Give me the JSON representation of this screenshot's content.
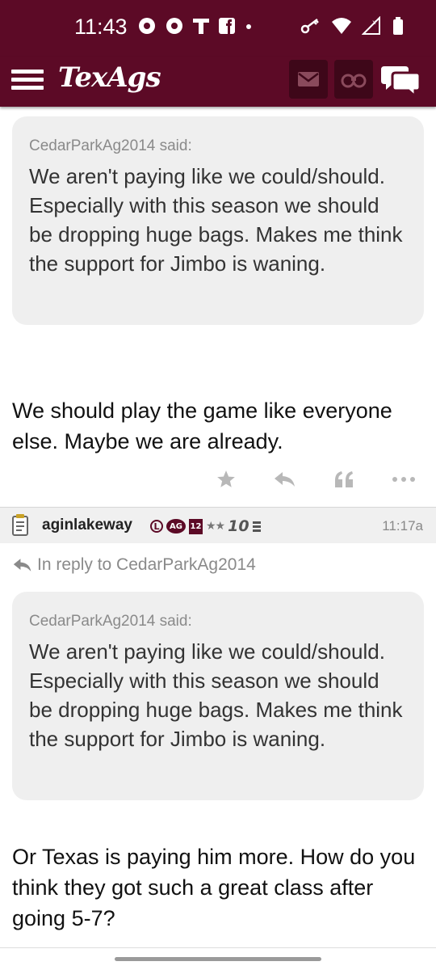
{
  "status_bar": {
    "time": "11:43"
  },
  "app": {
    "logo": "TexAgs"
  },
  "posts": [
    {
      "quote": {
        "author": "CedarParkAg2014 said:",
        "text": "We aren't paying like we could/should. Especially with this season we should be dropping huge bags. Makes me think the support for Jimbo is waning."
      },
      "body": "We should play the game like everyone else. Maybe we are already."
    },
    {
      "username": "aginlakeway",
      "badges": {
        "l": "L",
        "ag": "AG",
        "twelve": "12",
        "stars": "★★",
        "rank": "10"
      },
      "time": "11:17a",
      "reply_to": "In reply to CedarParkAg2014",
      "quote": {
        "author": "CedarParkAg2014 said:",
        "text": "We aren't paying like we could/should. Especially with this season we should be dropping huge bags. Makes me think the support for Jimbo is waning."
      },
      "body": "Or Texas is paying him more. How do you think they got such a great class after going 5-7?"
    }
  ],
  "icons": [
    "menu-icon",
    "mail-icon",
    "binoculars-icon",
    "chat-icon",
    "star-icon",
    "reply-icon",
    "quote-icon",
    "more-icon",
    "notepad-icon"
  ],
  "colors": {
    "brand": "#5c0a26",
    "quote_bg": "#efefef",
    "icon_gray": "#b8b8b8"
  }
}
